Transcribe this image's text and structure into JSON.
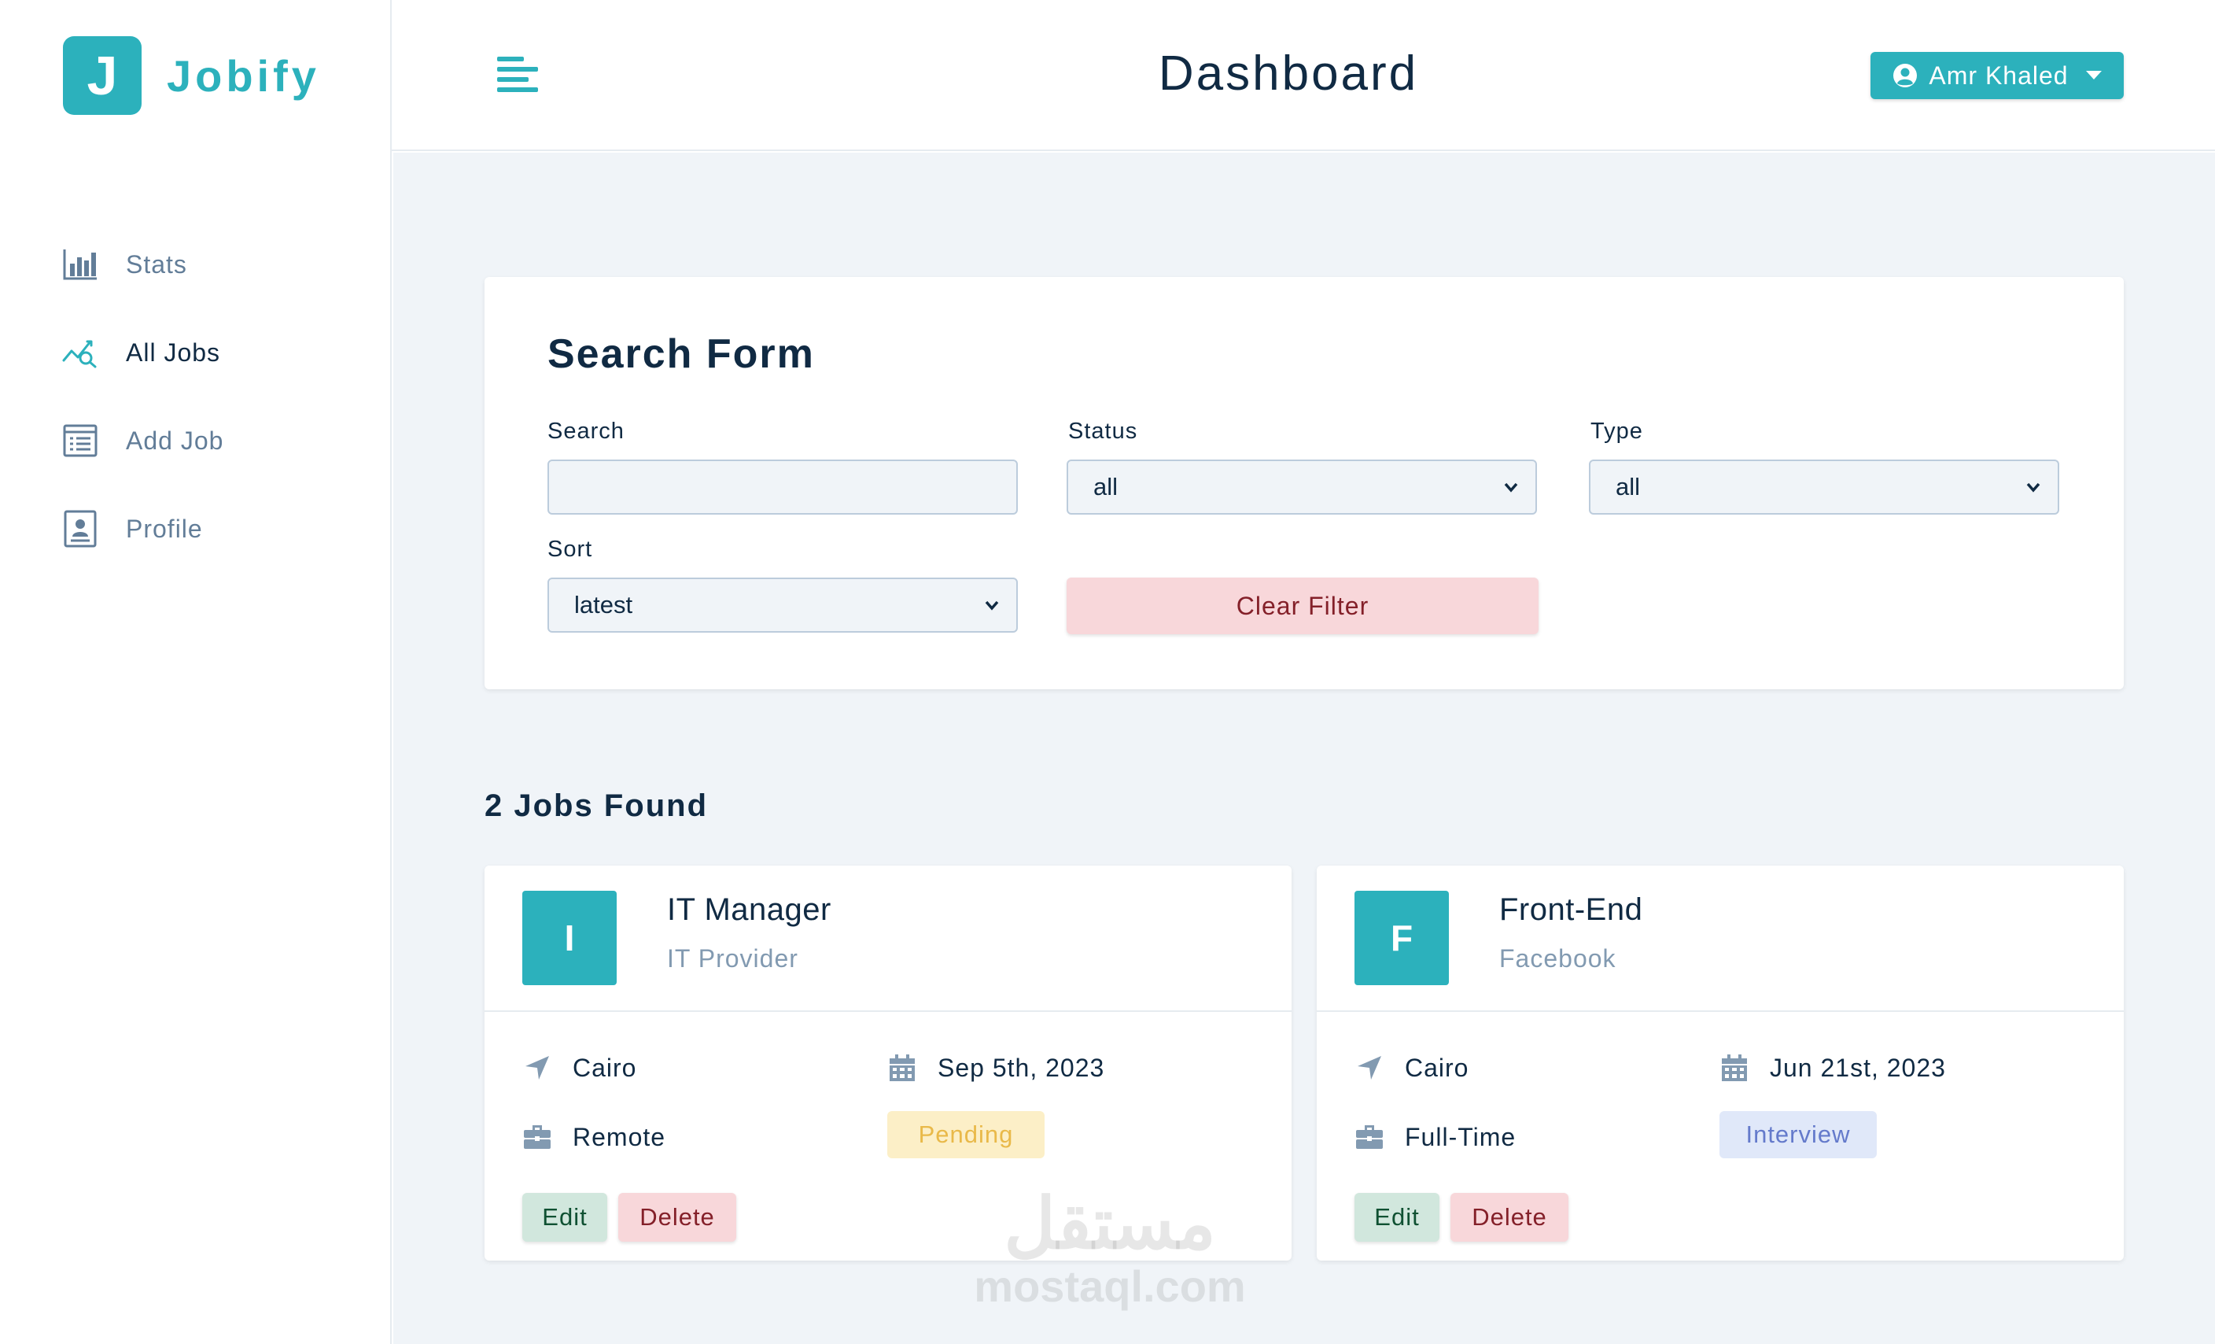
{
  "brand": {
    "initial": "J",
    "name": "Jobify",
    "color": "#2cb1bc"
  },
  "header": {
    "title": "Dashboard",
    "user_name": "Amr Khaled"
  },
  "sidebar": {
    "items": [
      {
        "label": "Stats",
        "icon": "bar-chart-icon",
        "active": false
      },
      {
        "label": "All Jobs",
        "icon": "chart-search-icon",
        "active": true
      },
      {
        "label": "Add Job",
        "icon": "form-icon",
        "active": false
      },
      {
        "label": "Profile",
        "icon": "id-card-icon",
        "active": false
      }
    ]
  },
  "search_form": {
    "title": "Search Form",
    "search_label": "Search",
    "search_value": "",
    "status_label": "Status",
    "status_value": "all",
    "type_label": "Type",
    "type_value": "all",
    "sort_label": "Sort",
    "sort_value": "latest",
    "clear_label": "Clear Filter"
  },
  "jobs_found": "2 Jobs Found",
  "jobs": [
    {
      "initial": "I",
      "position": "IT Manager",
      "company": "IT Provider",
      "location": "Cairo",
      "date": "Sep 5th, 2023",
      "job_type": "Remote",
      "status": "Pending",
      "status_bg": "#fcefc7",
      "status_color": "#e9b949",
      "edit_label": "Edit",
      "delete_label": "Delete"
    },
    {
      "initial": "F",
      "position": "Front-End",
      "company": "Facebook",
      "location": "Cairo",
      "date": "Jun 21st, 2023",
      "job_type": "Full-Time",
      "status": "Interview",
      "status_bg": "#e0e8f9",
      "status_color": "#647acb",
      "edit_label": "Edit",
      "delete_label": "Delete"
    }
  ],
  "watermark": {
    "arabic": "مستقل",
    "latin": "mostaql.com"
  }
}
